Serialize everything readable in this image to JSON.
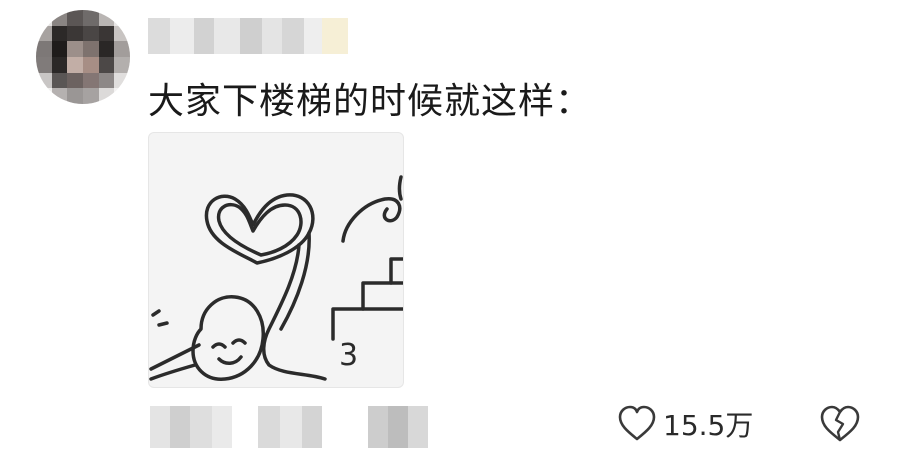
{
  "comment": {
    "text": "大家下楼梯的时候就这样："
  },
  "sticker": {
    "caption_mark": "3"
  },
  "actions": {
    "like_count": "15.5万",
    "like_icon": "heart-outline-icon",
    "dislike_icon": "broken-heart-icon"
  },
  "colors": {
    "text": "#1a1a1a",
    "icon": "#3a3a3a",
    "sticker_bg": "#f4f4f4"
  }
}
